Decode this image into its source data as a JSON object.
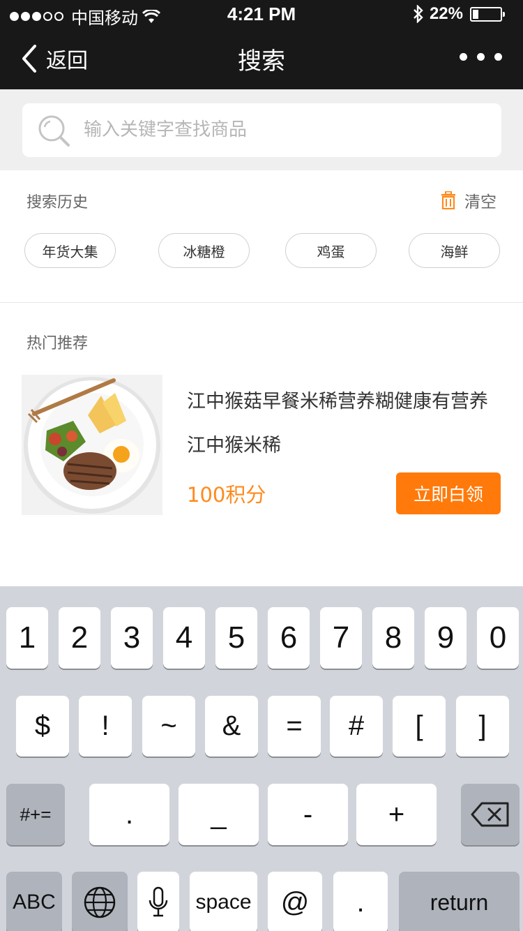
{
  "status_bar": {
    "carrier": "中国移动",
    "time": "4:21 PM",
    "battery_percent": "22%",
    "battery_level": 0.22,
    "signal_bars_filled": 3,
    "signal_bars_total": 5
  },
  "nav": {
    "back_label": "返回",
    "title": "搜索"
  },
  "search": {
    "placeholder": "输入关键字查找商品",
    "value": ""
  },
  "history": {
    "title": "搜索历史",
    "clear_label": "清空",
    "tags": [
      "年货大集",
      "冰糖橙",
      "鸡蛋",
      "海鲜"
    ]
  },
  "hot": {
    "title": "热门推荐",
    "product": {
      "title": "江中猴菇早餐米稀营养糊健康有营养江中猴米稀",
      "price": "100积分",
      "button": "立即白领"
    }
  },
  "keyboard": {
    "row1": [
      "1",
      "2",
      "3",
      "4",
      "5",
      "6",
      "7",
      "8",
      "9",
      "0"
    ],
    "row2": [
      "$",
      "!",
      "~",
      "&",
      "=",
      "#",
      "[",
      "]"
    ],
    "row3": {
      "mode": "#+=",
      "keys": [
        ".",
        "_",
        "-",
        "+"
      ]
    },
    "row4": {
      "abc": "ABC",
      "space": "space",
      "at": "@",
      "dot": ".",
      "return": "return"
    }
  },
  "colors": {
    "accent": "#ff7a0a",
    "price": "#ff8a1d",
    "nav_bg": "#181818",
    "search_bg": "#efefef",
    "keyboard_bg": "#d1d5db"
  },
  "icons": [
    "back-chevron-icon",
    "more-icon",
    "search-icon",
    "trash-icon",
    "wifi-icon",
    "bluetooth-icon",
    "battery-icon",
    "backspace-icon",
    "globe-icon",
    "microphone-icon"
  ]
}
